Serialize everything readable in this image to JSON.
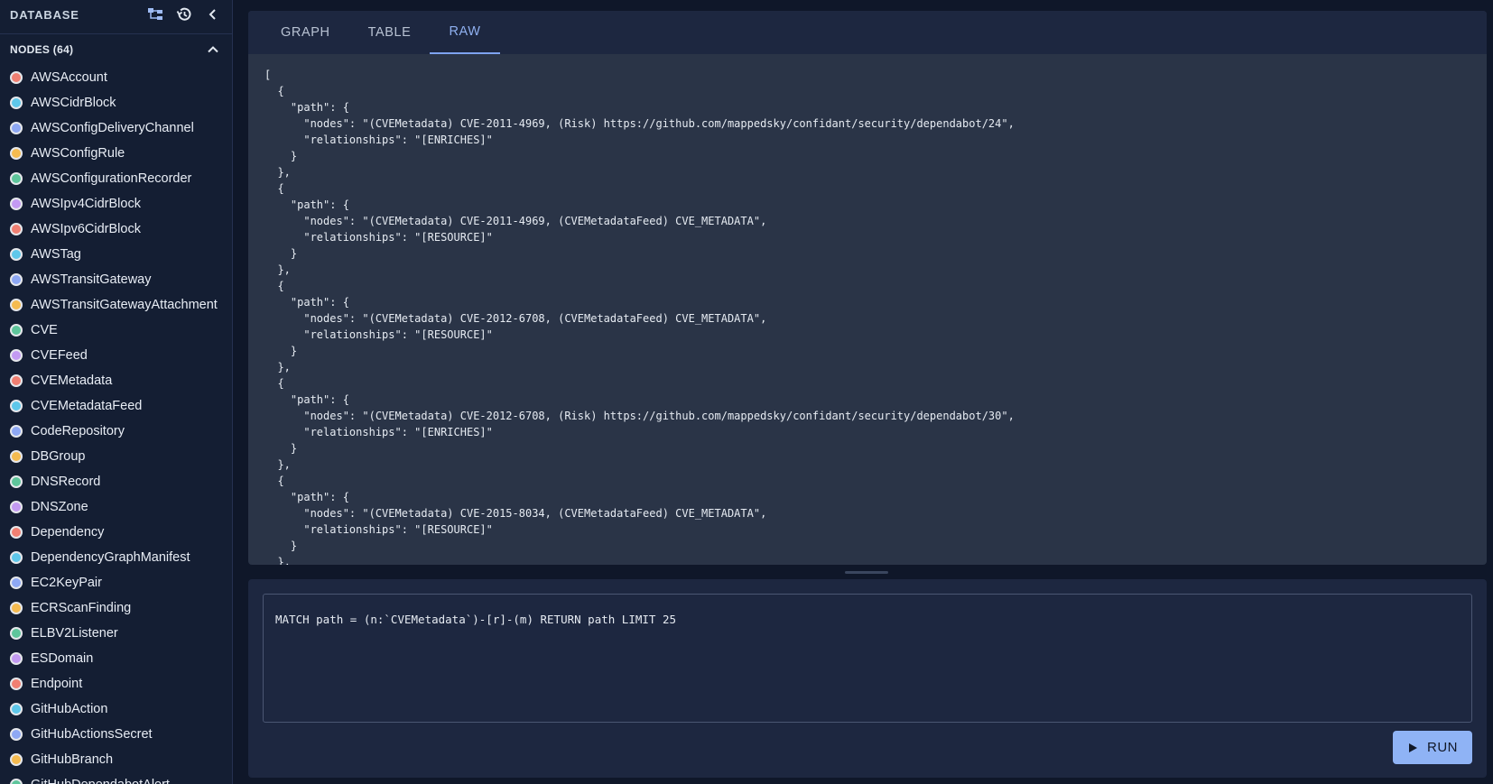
{
  "sidebar": {
    "title": "DATABASE",
    "icons": [
      "schema-icon",
      "history-icon",
      "chevron-left-icon"
    ],
    "section_title": "NODES (64)",
    "nodes": [
      {
        "label": "AWSAccount",
        "color": "#f07f72"
      },
      {
        "label": "AWSCidrBlock",
        "color": "#5ec7ea"
      },
      {
        "label": "AWSConfigDeliveryChannel",
        "color": "#8ea8f4"
      },
      {
        "label": "AWSConfigRule",
        "color": "#f5bb50"
      },
      {
        "label": "AWSConfigurationRecorder",
        "color": "#5ec59b"
      },
      {
        "label": "AWSIpv4CidrBlock",
        "color": "#c39af2"
      },
      {
        "label": "AWSIpv6CidrBlock",
        "color": "#f07f72"
      },
      {
        "label": "AWSTag",
        "color": "#5ec7ea"
      },
      {
        "label": "AWSTransitGateway",
        "color": "#8ea8f4"
      },
      {
        "label": "AWSTransitGatewayAttachment",
        "color": "#f5bb50"
      },
      {
        "label": "CVE",
        "color": "#5ec59b"
      },
      {
        "label": "CVEFeed",
        "color": "#c39af2"
      },
      {
        "label": "CVEMetadata",
        "color": "#f07f72"
      },
      {
        "label": "CVEMetadataFeed",
        "color": "#5ec7ea"
      },
      {
        "label": "CodeRepository",
        "color": "#8ea8f4"
      },
      {
        "label": "DBGroup",
        "color": "#f5bb50"
      },
      {
        "label": "DNSRecord",
        "color": "#5ec59b"
      },
      {
        "label": "DNSZone",
        "color": "#c39af2"
      },
      {
        "label": "Dependency",
        "color": "#f07f72"
      },
      {
        "label": "DependencyGraphManifest",
        "color": "#5ec7ea"
      },
      {
        "label": "EC2KeyPair",
        "color": "#8ea8f4"
      },
      {
        "label": "ECRScanFinding",
        "color": "#f5bb50"
      },
      {
        "label": "ELBV2Listener",
        "color": "#5ec59b"
      },
      {
        "label": "ESDomain",
        "color": "#c39af2"
      },
      {
        "label": "Endpoint",
        "color": "#f07f72"
      },
      {
        "label": "GitHubAction",
        "color": "#5ec7ea"
      },
      {
        "label": "GitHubActionsSecret",
        "color": "#8ea8f4"
      },
      {
        "label": "GitHubBranch",
        "color": "#f5bb50"
      },
      {
        "label": "GitHubDependabotAlert",
        "color": "#5ec59b"
      }
    ]
  },
  "results": {
    "tabs": [
      {
        "label": "GRAPH",
        "active": false
      },
      {
        "label": "TABLE",
        "active": false
      },
      {
        "label": "RAW",
        "active": true
      }
    ],
    "raw_text": "[\n  {\n    \"path\": {\n      \"nodes\": \"(CVEMetadata) CVE-2011-4969, (Risk) https://github.com/mappedsky/confidant/security/dependabot/24\",\n      \"relationships\": \"[ENRICHES]\"\n    }\n  },\n  {\n    \"path\": {\n      \"nodes\": \"(CVEMetadata) CVE-2011-4969, (CVEMetadataFeed) CVE_METADATA\",\n      \"relationships\": \"[RESOURCE]\"\n    }\n  },\n  {\n    \"path\": {\n      \"nodes\": \"(CVEMetadata) CVE-2012-6708, (CVEMetadataFeed) CVE_METADATA\",\n      \"relationships\": \"[RESOURCE]\"\n    }\n  },\n  {\n    \"path\": {\n      \"nodes\": \"(CVEMetadata) CVE-2012-6708, (Risk) https://github.com/mappedsky/confidant/security/dependabot/30\",\n      \"relationships\": \"[ENRICHES]\"\n    }\n  },\n  {\n    \"path\": {\n      \"nodes\": \"(CVEMetadata) CVE-2015-8034, (CVEMetadataFeed) CVE_METADATA\",\n      \"relationships\": \"[RESOURCE]\"\n    }\n  },"
  },
  "query": {
    "text": "MATCH path = (n:`CVEMetadata`)-[r]-(m) RETURN path LIMIT 25",
    "run_label": "RUN"
  }
}
